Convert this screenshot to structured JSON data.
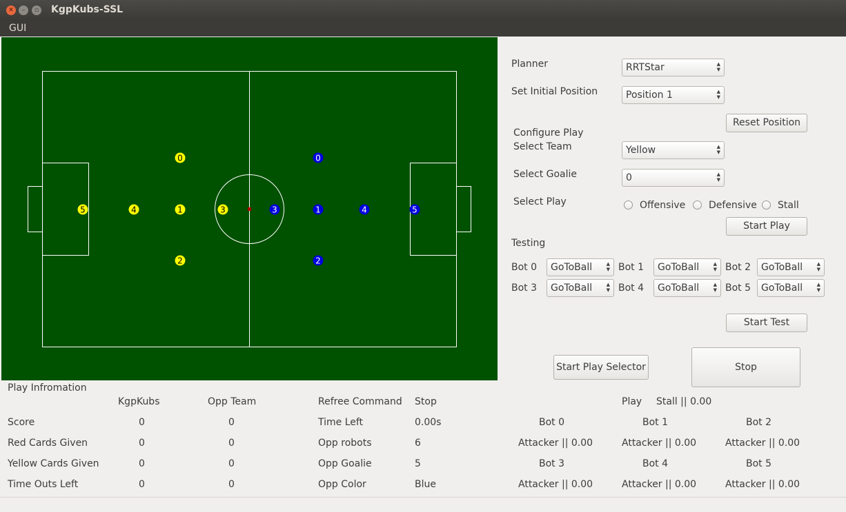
{
  "window": {
    "title": "KgpKubs-SSL",
    "menu": [
      "GUI"
    ],
    "buttons": [
      "close-icon",
      "minimize-icon",
      "maximize-icon"
    ]
  },
  "field": {
    "colors": {
      "field": "#005100",
      "lines": "#ffffff",
      "yellow_bot": "#ffff00",
      "blue_bot": "#0000e0",
      "ball": "#b00000"
    },
    "yellow_team": [
      {
        "id": "0",
        "label": "0"
      },
      {
        "id": "1",
        "label": "1"
      },
      {
        "id": "2",
        "label": "2"
      },
      {
        "id": "3",
        "label": "3"
      },
      {
        "id": "4",
        "label": "4"
      },
      {
        "id": "5",
        "label": "5"
      }
    ],
    "blue_team": [
      {
        "id": "0",
        "label": "0"
      },
      {
        "id": "1",
        "label": "1"
      },
      {
        "id": "2",
        "label": "2"
      },
      {
        "id": "3",
        "label": "3"
      },
      {
        "id": "4",
        "label": "4"
      },
      {
        "id": "5",
        "label": "5"
      }
    ]
  },
  "controls": {
    "planner_label": "Planner",
    "planner_value": "RRTStar",
    "initial_position_label": "Set Initial Position",
    "initial_position_value": "Position 1",
    "reset_position": "Reset Position",
    "configure_play": "Configure Play",
    "select_team_label": "Select Team",
    "select_team_value": "Yellow",
    "select_goalie_label": "Select Goalie",
    "select_goalie_value": "0",
    "select_play_label": "Select Play",
    "play_options": [
      "Offensive",
      "Defensive",
      "Stall"
    ],
    "start_play": "Start Play",
    "testing_label": "Testing",
    "test_bots": [
      {
        "label": "Bot 0",
        "value": "GoToBall"
      },
      {
        "label": "Bot 1",
        "value": "GoToBall"
      },
      {
        "label": "Bot 2",
        "value": "GoToBall"
      },
      {
        "label": "Bot 3",
        "value": "GoToBall"
      },
      {
        "label": "Bot 4",
        "value": "GoToBall"
      },
      {
        "label": "Bot 5",
        "value": "GoToBall"
      }
    ],
    "start_test": "Start Test",
    "start_play_selector": "Start Play Selector",
    "stop": "Stop"
  },
  "info": {
    "section_title": "Play Infromation",
    "col_kgpkubs": "KgpKubs",
    "col_opp": "Opp Team",
    "rows": [
      {
        "label": "Score",
        "kgp": "0",
        "opp": "0"
      },
      {
        "label": "Red Cards Given",
        "kgp": "0",
        "opp": "0"
      },
      {
        "label": "Yellow Cards Given",
        "kgp": "0",
        "opp": "0"
      },
      {
        "label": "Time Outs Left",
        "kgp": "0",
        "opp": "0"
      }
    ],
    "referee": [
      {
        "label": "Refree Command",
        "value": "Stop"
      },
      {
        "label": "Time Left",
        "value": "0.00s"
      },
      {
        "label": "Opp robots",
        "value": "6"
      },
      {
        "label": "Opp Goalie",
        "value": "5"
      },
      {
        "label": "Opp Color",
        "value": "Blue"
      }
    ],
    "play_label": "Play",
    "play_value": "Stall || 0.00",
    "bots": [
      {
        "name": "Bot 0",
        "status": "Attacker || 0.00"
      },
      {
        "name": "Bot 1",
        "status": "Attacker || 0.00"
      },
      {
        "name": "Bot 2",
        "status": "Attacker || 0.00"
      },
      {
        "name": "Bot 3",
        "status": "Attacker || 0.00"
      },
      {
        "name": "Bot 4",
        "status": "Attacker || 0.00"
      },
      {
        "name": "Bot 5",
        "status": "Attacker || 0.00"
      }
    ]
  }
}
